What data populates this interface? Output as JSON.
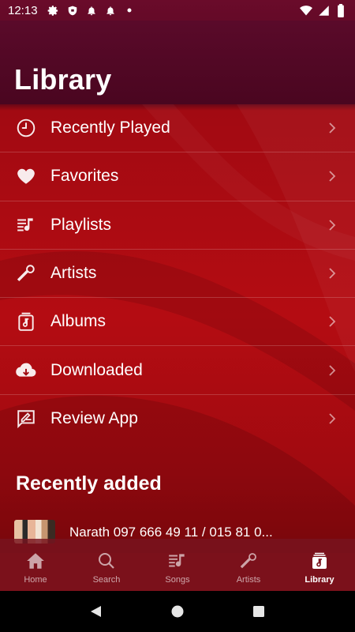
{
  "status_bar": {
    "time": "12:13",
    "icons": [
      "gear-icon",
      "shield-icon",
      "bell-icon",
      "bell-icon",
      "dot-icon"
    ],
    "right_icons": [
      "wifi-icon",
      "cellular-icon",
      "battery-icon"
    ]
  },
  "header": {
    "title": "Library"
  },
  "menu": {
    "items": [
      {
        "label": "Recently Played",
        "icon": "clock-icon"
      },
      {
        "label": "Favorites",
        "icon": "heart-icon"
      },
      {
        "label": "Playlists",
        "icon": "playlist-icon"
      },
      {
        "label": "Artists",
        "icon": "microphone-icon"
      },
      {
        "label": "Albums",
        "icon": "album-icon"
      },
      {
        "label": "Downloaded",
        "icon": "cloud-download-icon"
      },
      {
        "label": "Review App",
        "icon": "review-icon"
      }
    ]
  },
  "recently_added": {
    "title": "Recently added",
    "items": [
      {
        "title": "Narath 097 666 49 11 / 015 81 0..."
      }
    ]
  },
  "bottom_nav": {
    "items": [
      {
        "label": "Home",
        "icon": "home-icon",
        "active": false
      },
      {
        "label": "Search",
        "icon": "search-icon",
        "active": false
      },
      {
        "label": "Songs",
        "icon": "songs-icon",
        "active": false
      },
      {
        "label": "Artists",
        "icon": "microphone-icon",
        "active": false
      },
      {
        "label": "Library",
        "icon": "library-icon",
        "active": true
      }
    ]
  },
  "system_nav": [
    "back-icon",
    "home-circle-icon",
    "recents-icon"
  ],
  "colors": {
    "header_bg": "#4a0620",
    "content_bg": "#b40c12",
    "bottom_nav_bg": "#78141e",
    "text": "#ffffff"
  }
}
